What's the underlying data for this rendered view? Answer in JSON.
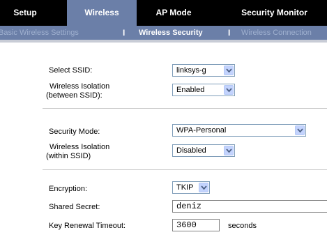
{
  "topnav": {
    "tabs": [
      {
        "label": "Setup"
      },
      {
        "label": "Wireless"
      },
      {
        "label": "AP Mode"
      },
      {
        "label": "Security Monitor"
      }
    ]
  },
  "subnav": {
    "items": [
      {
        "label": "Basic Wireless Settings"
      },
      {
        "label": "Wireless Security"
      },
      {
        "label": "Wireless Connection"
      }
    ],
    "separator": "I"
  },
  "form": {
    "select_ssid": {
      "label": "Select SSID:",
      "value": "linksys-g"
    },
    "isolation_between": {
      "label_line1": "Wireless Isolation",
      "label_line2": "(between SSID):",
      "value": "Enabled"
    },
    "security_mode": {
      "label": "Security Mode:",
      "value": "WPA-Personal"
    },
    "isolation_within": {
      "label_line1": "Wireless Isolation",
      "label_line2": "(within SSID)",
      "value": "Disabled"
    },
    "encryption": {
      "label": "Encryption:",
      "value": "TKIP"
    },
    "shared_secret": {
      "label": "Shared Secret:",
      "value": "deniz"
    },
    "key_renewal": {
      "label": "Key Renewal Timeout:",
      "value": "3600",
      "unit": "seconds"
    }
  },
  "colors": {
    "nav_bg": "#000000",
    "active_tab": "#6b7fa8",
    "dropdown_button": "#c3d3fd"
  },
  "icons": {
    "dropdown": "chevron-down-icon"
  }
}
